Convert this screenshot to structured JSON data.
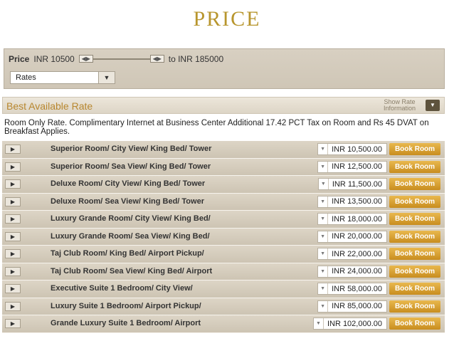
{
  "page": {
    "title": "PRICE"
  },
  "filter": {
    "price_label": "Price",
    "min_price": "INR 10500",
    "max_price": "to INR 185000",
    "rates_select": "Rates"
  },
  "rate_section": {
    "heading": "Best Available Rate",
    "show_info_line1": "Show Rate",
    "show_info_line2": "Information",
    "description": "Room Only Rate. Complimentary Internet at Business Center Additional 17.42 PCT Tax on Room and Rs 45 DVAT on Breakfast Applies."
  },
  "rooms": [
    {
      "name": "Superior Room/ City View/ King Bed/ Tower",
      "price": "INR 10,500.00",
      "action": "Book Room"
    },
    {
      "name": "Superior Room/ Sea View/ King Bed/ Tower",
      "price": "INR 12,500.00",
      "action": "Book Room"
    },
    {
      "name": "Deluxe Room/ City View/ King Bed/ Tower",
      "price": "INR 11,500.00",
      "action": "Book Room"
    },
    {
      "name": "Deluxe Room/ Sea View/ King Bed/ Tower",
      "price": "INR 13,500.00",
      "action": "Book Room"
    },
    {
      "name": "Luxury Grande Room/ City View/ King Bed/",
      "price": "INR 18,000.00",
      "action": "Book Room"
    },
    {
      "name": "Luxury Grande Room/ Sea View/ King Bed/",
      "price": "INR 20,000.00",
      "action": "Book Room"
    },
    {
      "name": "Taj Club Room/ King Bed/ Airport Pickup/",
      "price": "INR 22,000.00",
      "action": "Book Room"
    },
    {
      "name": "Taj Club Room/ Sea View/ King Bed/ Airport",
      "price": "INR 24,000.00",
      "action": "Book Room"
    },
    {
      "name": "Executive Suite 1 Bedroom/ City View/",
      "price": "INR 58,000.00",
      "action": "Book Room"
    },
    {
      "name": "Luxury Suite 1 Bedroom/ Airport Pickup/",
      "price": "INR 85,000.00",
      "action": "Book Room"
    },
    {
      "name": "Grande Luxury Suite 1 Bedroom/ Airport",
      "price": "INR 102,000.00",
      "action": "Book Room"
    }
  ],
  "colors": {
    "title": "#b8962e",
    "heading": "#b8872f",
    "book_button": "#d9a23a"
  }
}
